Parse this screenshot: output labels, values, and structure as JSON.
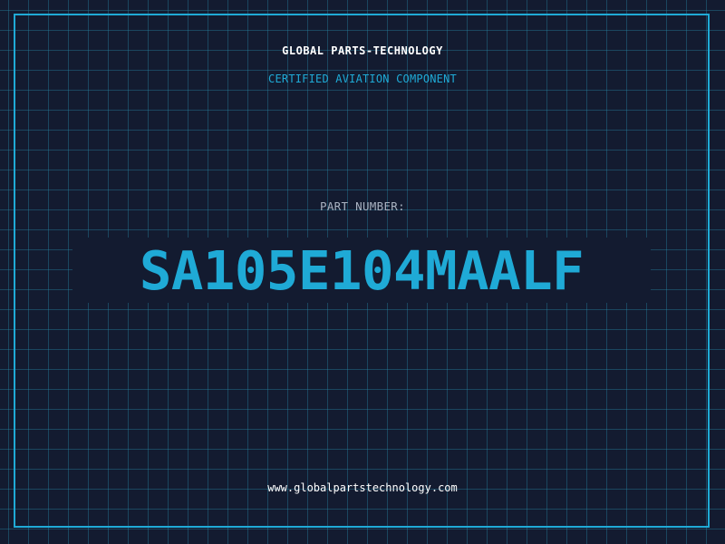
{
  "header": {
    "company": "GLOBAL PARTS-TECHNOLOGY",
    "subtitle": "CERTIFIED AVIATION COMPONENT"
  },
  "part": {
    "label": "PART NUMBER:",
    "number": "SA105E104MAALF"
  },
  "footer": {
    "website": "www.globalpartstechnology.com"
  },
  "colors": {
    "background": "#131b30",
    "accent": "#1faad6",
    "grid": "#26829f",
    "label": "#aab3c2",
    "text": "#ffffff"
  }
}
